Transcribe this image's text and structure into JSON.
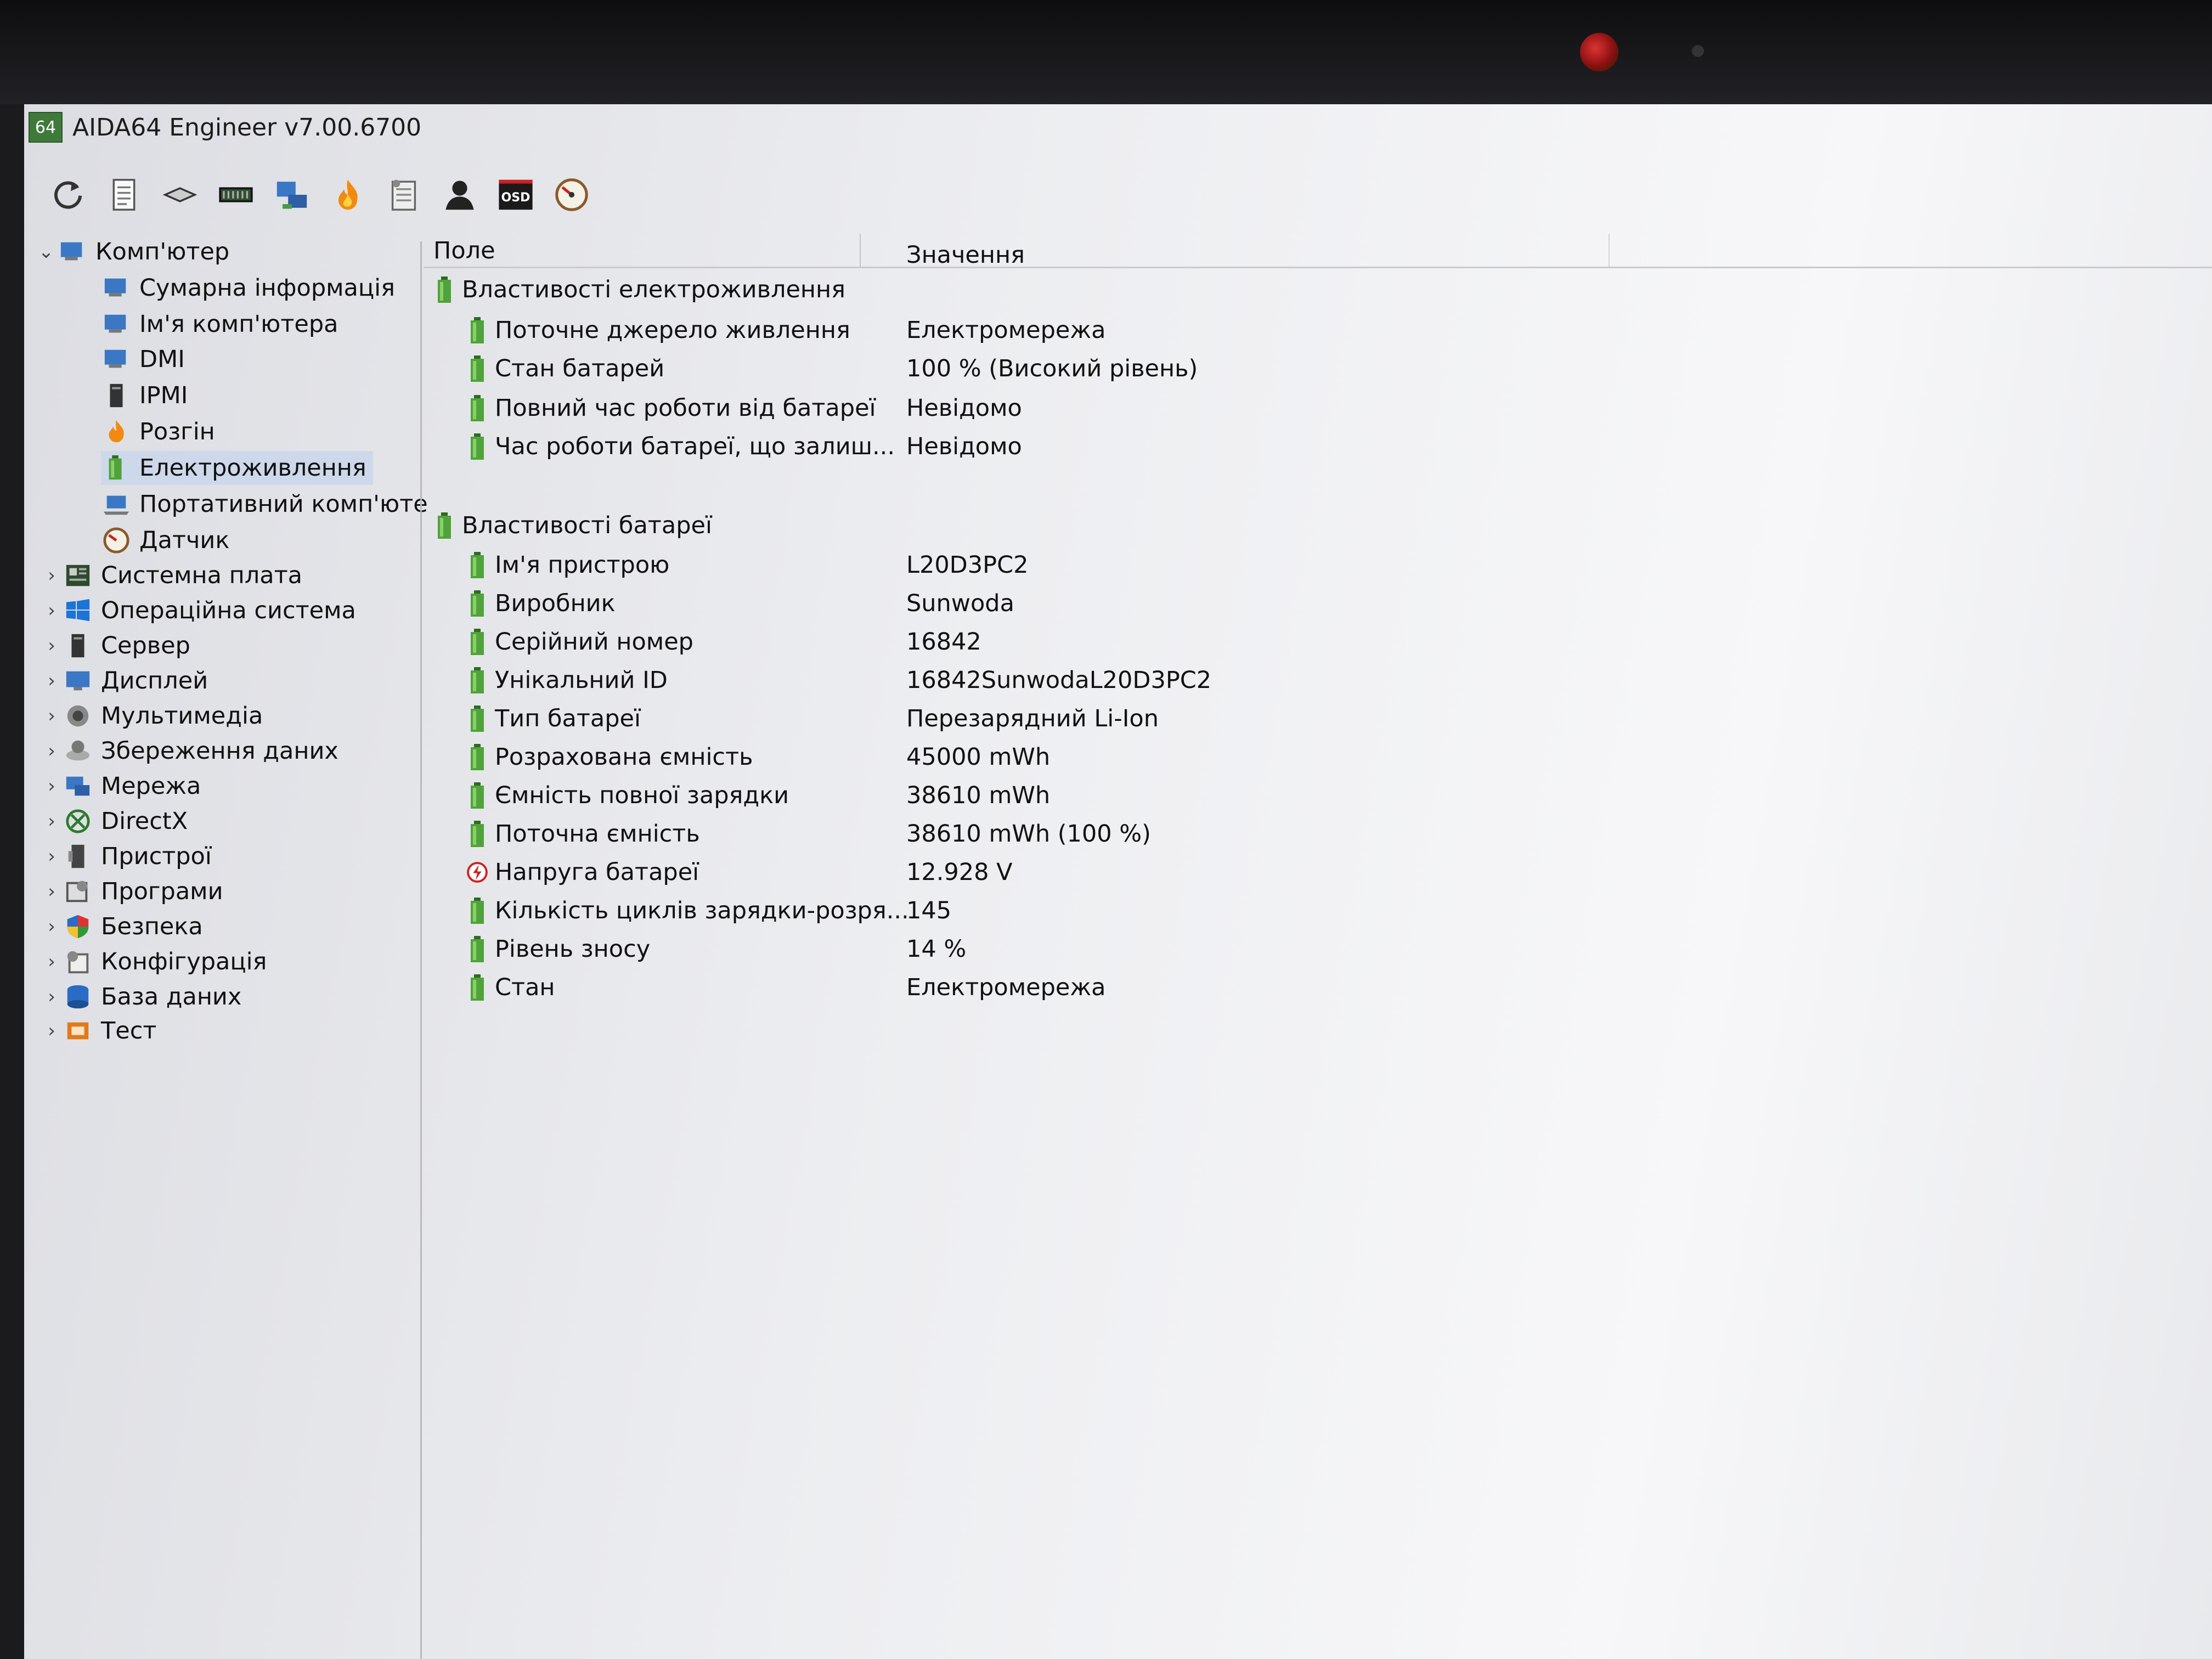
{
  "window": {
    "icon_text": "64",
    "title": "AIDA64 Engineer v7.00.6700"
  },
  "toolbar": [
    "refresh-icon",
    "report-icon",
    "storage-icon",
    "memory-icon",
    "network-icon",
    "burn-in-icon",
    "benchmark-icon",
    "user-icon",
    "osd-icon",
    "sensor-icon"
  ],
  "toolbar_osd_label": "OSD",
  "tree": {
    "root": "Комп'ютер",
    "children": [
      "Сумарна інформація",
      "Ім'я комп'ютера",
      "DMI",
      "IPMI",
      "Розгін",
      "Електроживлення",
      "Портативний комп'юте",
      "Датчик"
    ],
    "top": [
      "Системна плата",
      "Операційна система",
      "Сервер",
      "Дисплей",
      "Мультимедіа",
      "Збереження даних",
      "Мережа",
      "DirectX",
      "Пристрої",
      "Програми",
      "Безпека",
      "Конфігурація",
      "База даних",
      "Тест"
    ]
  },
  "list": {
    "col_field": "Поле",
    "col_value": "Значення",
    "group1": "Властивості електроживлення",
    "group1_rows": [
      {
        "field": "Поточне джерело живлення",
        "value": "Електромережа"
      },
      {
        "field": "Стан батарей",
        "value": "100 % (Високий рівень)"
      },
      {
        "field": "Повний час роботи від батареї",
        "value": "Невідомо"
      },
      {
        "field": "Час роботи батареї, що залиш...",
        "value": "Невідомо"
      }
    ],
    "group2": "Властивості батареї",
    "group2_rows": [
      {
        "field": "Ім'я пристрою",
        "value": "L20D3PC2"
      },
      {
        "field": "Виробник",
        "value": "Sunwoda"
      },
      {
        "field": "Серійний номер",
        "value": "16842"
      },
      {
        "field": "Унікальний ID",
        "value": "16842SunwodaL20D3PC2"
      },
      {
        "field": "Тип батареї",
        "value": "Перезарядний Li-Ion"
      },
      {
        "field": "Розрахована ємність",
        "value": "45000 mWh"
      },
      {
        "field": "Ємність повної зарядки",
        "value": "38610 mWh"
      },
      {
        "field": "Поточна ємність",
        "value": "38610 mWh  (100 %)"
      },
      {
        "field": "Напруга батареї",
        "value": "12.928 V"
      },
      {
        "field": "Кількість циклів зарядки-розря...",
        "value": "145"
      },
      {
        "field": "Рівень зносу",
        "value": "14 %"
      },
      {
        "field": "Стан",
        "value": "Електромережа"
      }
    ]
  }
}
